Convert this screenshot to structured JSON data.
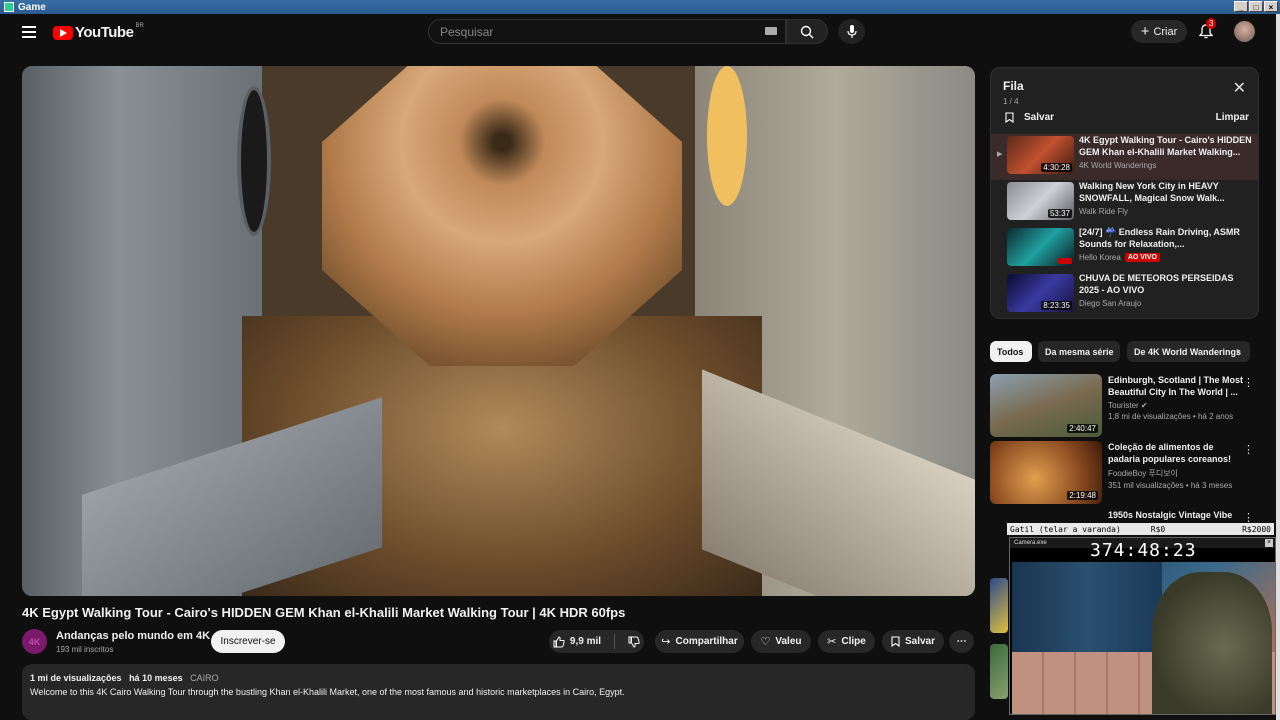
{
  "window": {
    "title": "Game"
  },
  "header": {
    "logo_text": "YouTube",
    "logo_country": "BR",
    "search_placeholder": "Pesquisar",
    "create_label": "Criar",
    "notification_count": "3"
  },
  "video": {
    "title": "4K Egypt Walking Tour - Cairo's HIDDEN GEM Khan el-Khalili Market Walking Tour | 4K HDR 60fps",
    "channel_initials": "4K",
    "channel_name": "Andanças pelo mundo em 4K",
    "subscribers": "193 mil inscritos",
    "subscribe_label": "Inscrever-se",
    "likes": "9,9 mil",
    "share_label": "Compartilhar",
    "thanks_label": "Valeu",
    "clip_label": "Clipe",
    "save_label": "Salvar",
    "more_label": "⋯"
  },
  "description": {
    "views": "1 mi de visualizações",
    "age": "há 10 meses",
    "tag": "CAIRO",
    "text": "Welcome to this 4K Cairo Walking Tour through the bustling Khan el-Khalili Market, one of the most famous and historic marketplaces in Cairo, Egypt."
  },
  "queue": {
    "title": "Fila",
    "count": "1 / 4",
    "save_label": "Salvar",
    "clear_label": "Limpar",
    "items": [
      {
        "title": "4K Egypt Walking Tour - Cairo's HIDDEN GEM Khan el-Khalili Market Walking...",
        "channel": "4K World Wanderings",
        "duration": "4:30:28",
        "active": true
      },
      {
        "title": "Walking New York City in HEAVY SNOWFALL, Magical Snow Walk...",
        "channel": "Walk Ride Fly",
        "duration": "53:37"
      },
      {
        "title": "[24/7] ☔ Endless Rain Driving, ASMR Sounds for Relaxation,...",
        "channel": "Hello Korea",
        "live_label": "AO VIVO"
      },
      {
        "title": "CHUVA DE METEOROS PERSEIDAS 2025 - AO VIVO",
        "channel": "Diego San Araujo",
        "duration": "8:23:35"
      }
    ]
  },
  "chips": [
    "Todos",
    "Da mesma série",
    "De 4K World Wanderings"
  ],
  "recommendations": [
    {
      "title": "Edinburgh, Scotland | The Most Beautiful City In The World | ...",
      "channel": "Tourister ✔",
      "meta": "1,8 mi de visualizações • há 2 anos",
      "duration": "2:40:47"
    },
    {
      "title": "Coleção de alimentos de padaria populares coreanos!",
      "channel": "FoodieBoy 푸디보이",
      "meta": "351 mil visualizações • há 3 meses",
      "duration": "2:19:48"
    },
    {
      "title": "1950s Nostalgic Vintage Vibe",
      "channel": "",
      "meta": "",
      "duration": ""
    }
  ],
  "overlay": {
    "goal_label": "Gatil (telar a varanda)",
    "goal_current": "R$0",
    "goal_target": "R$2000",
    "webcam_title": "Camera.exe",
    "timer": "374:48:23"
  },
  "colors": {
    "accent": "#ff0000",
    "live": "#cc0000",
    "background": "#0f0f0f"
  }
}
